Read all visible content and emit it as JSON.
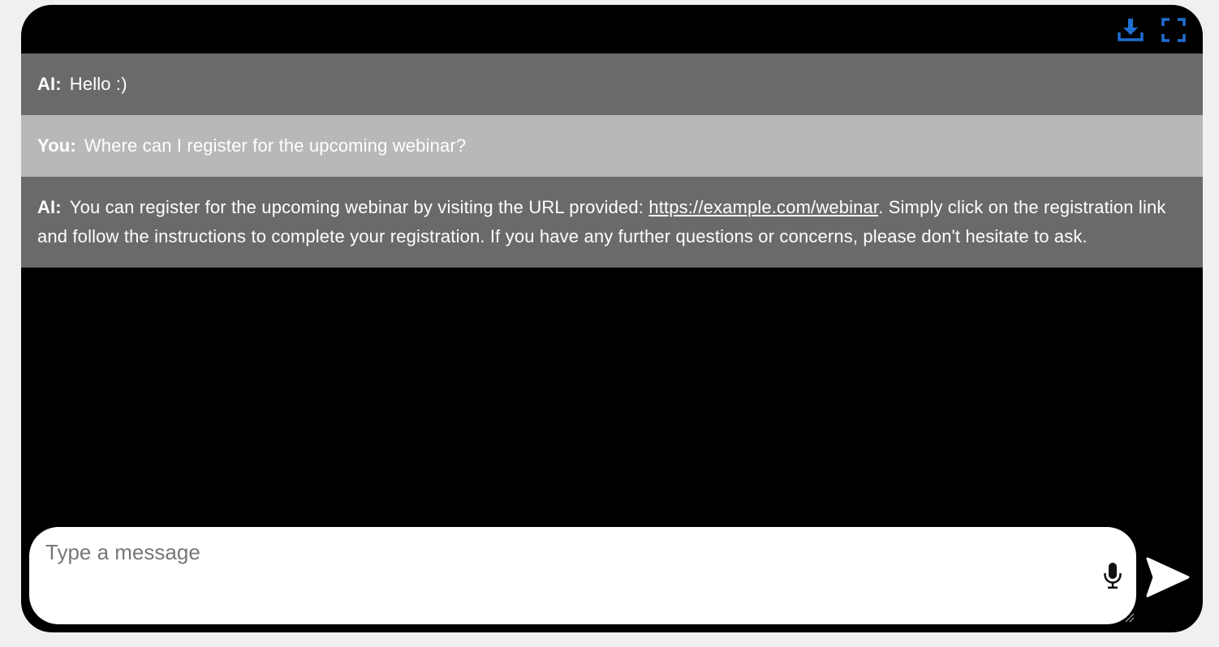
{
  "header": {
    "download_icon": "download-icon",
    "fullscreen_icon": "fullscreen-icon",
    "accent_color": "#1f6fd1"
  },
  "messages": [
    {
      "role": "ai",
      "sender": "AI:",
      "text": "Hello :)"
    },
    {
      "role": "user",
      "sender": "You:",
      "text": "Where can I register for the upcoming webinar?"
    },
    {
      "role": "ai",
      "sender": "AI:",
      "text_before": "You can register for the upcoming webinar by visiting the URL provided: ",
      "link": "https://example.com/webinar",
      "text_after": ". Simply click on the registration link and follow the instructions to complete your registration. If you have any further questions or concerns, please don't hesitate to ask."
    }
  ],
  "composer": {
    "placeholder": "Type a message",
    "value": "",
    "mic_icon": "microphone-icon",
    "send_icon": "send-icon"
  },
  "colors": {
    "window_bg": "#000000",
    "ai_bubble": "#6a6a6a",
    "user_bubble": "#b8b8b8",
    "page_bg": "#f0f0f0"
  }
}
